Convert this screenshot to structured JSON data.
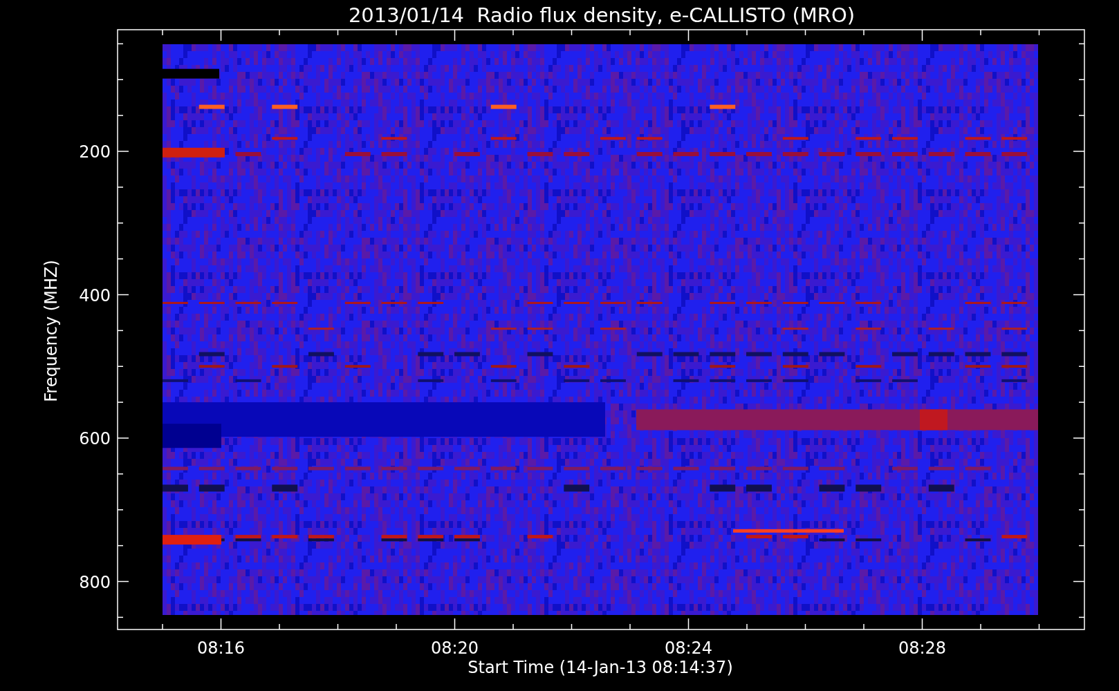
{
  "title": "2013/01/14  Radio flux density, e-CALLISTO (MRO)",
  "y_axis": {
    "label": "Frequency (MHZ)",
    "tick_labels": [
      "200",
      "400",
      "600",
      "800"
    ]
  },
  "x_axis": {
    "label": "Start Time (14-Jan-13 08:14:37)",
    "tick_labels": [
      "08:16",
      "08:20",
      "08:24",
      "08:28"
    ]
  }
}
